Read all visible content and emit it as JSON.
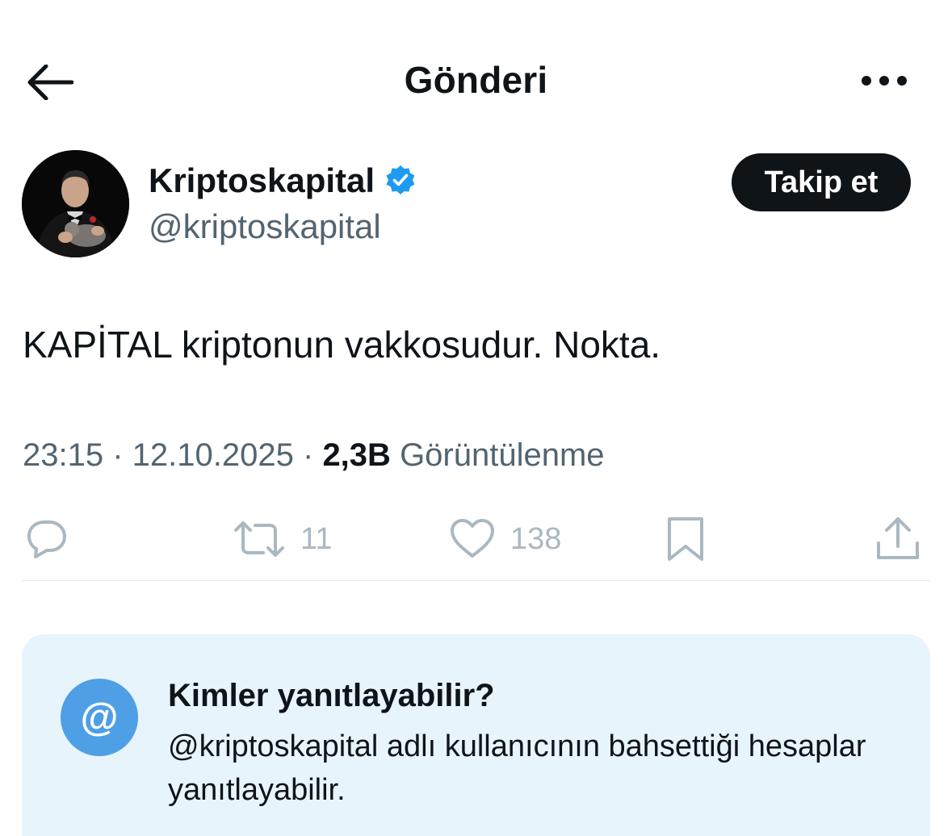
{
  "header": {
    "title": "Gönderi",
    "back_icon": "arrow-left-icon",
    "more_icon": "more-horizontal-icon"
  },
  "author": {
    "name": "Kriptoskapital",
    "handle": "@kriptoskapital",
    "verified_icon": "verified-badge-icon",
    "verified_color": "#1d9bf0",
    "follow_label": "Takip et"
  },
  "tweet": {
    "text": "KAPİTAL kriptonun vakkosudur. Nokta.",
    "time": "23:15",
    "date": "12.10.2025",
    "views_count": "2,3B",
    "views_label": "Görüntülenme"
  },
  "actions": {
    "reply_icon": "reply-icon",
    "retweet_icon": "retweet-icon",
    "retweet_count": "11",
    "like_icon": "heart-icon",
    "like_count": "138",
    "bookmark_icon": "bookmark-icon",
    "share_icon": "share-icon"
  },
  "reply_settings": {
    "icon": "at-sign-icon",
    "icon_glyph": "@",
    "title": "Kimler yanıtlayabilir?",
    "description": "@kriptoskapital adlı kullanıcının bahsettiği hesaplar yanıtlayabilir."
  }
}
